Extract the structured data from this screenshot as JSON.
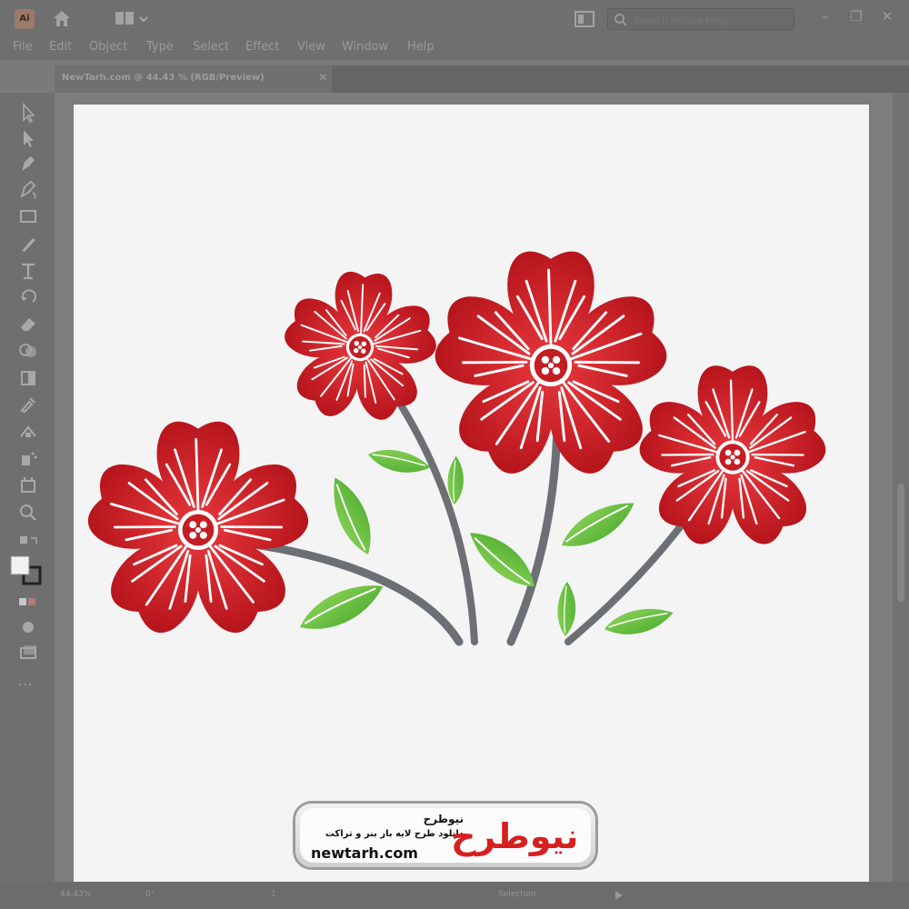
{
  "app": {
    "icon_label": "Ai"
  },
  "search": {
    "placeholder": "Search Adobe Help"
  },
  "window_controls": {
    "minimize": "–",
    "restore": "❐",
    "close": "✕"
  },
  "menu": [
    "File",
    "Edit",
    "Object",
    "Type",
    "Select",
    "Effect",
    "View",
    "Window",
    "Help"
  ],
  "document_tab": {
    "label": "NewTarh.com @ 44.43 % (RGB/Preview)",
    "close": "✕"
  },
  "toolbar": {
    "tools": [
      "selection-tool-icon",
      "direct-selection-tool-icon",
      "pen-tool-icon",
      "curvature-tool-icon",
      "rectangle-tool-icon",
      "paintbrush-tool-icon",
      "type-tool-icon",
      "rotate-tool-icon",
      "eraser-tool-icon",
      "shape-builder-tool-icon",
      "gradient-tool-icon",
      "eyedropper-tool-icon",
      "blend-tool-icon",
      "symbol-sprayer-tool-icon",
      "artboard-tool-icon",
      "zoom-tool-icon"
    ],
    "more": "..."
  },
  "status": {
    "zoom": "44.43%",
    "rotation": "0°",
    "artboard": "1",
    "tool": "Selection"
  },
  "badge": {
    "title": "نیوطرح",
    "subtitle": "دانلود طرح لایه باز بنر و تراکت",
    "url": "newtarh.com",
    "logo": "نیوطرح"
  },
  "colors": {
    "petal": "#c41d24",
    "petal_light": "#e4363b",
    "stem": "#6c7074",
    "leaf": "#5cb83a",
    "leaf_light": "#8fd65a",
    "artboard": "#f4f4f5",
    "chrome": "#6f6f6f"
  }
}
